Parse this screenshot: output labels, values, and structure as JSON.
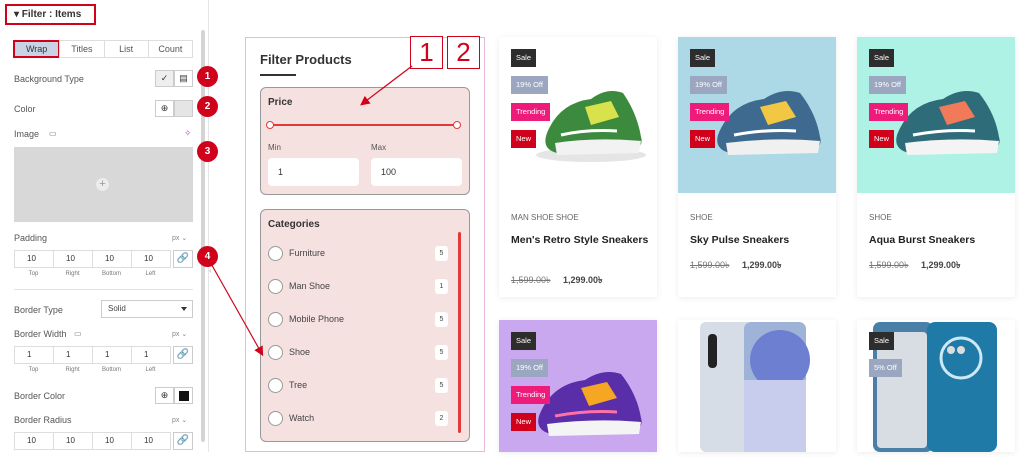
{
  "panel": {
    "section_title": "▾ Filter : Items",
    "tabs": [
      "Wrap",
      "Titles",
      "List",
      "Count"
    ],
    "background_type_label": "Background Type",
    "bg_icon_1": "✓",
    "bg_icon_2": "▤",
    "color_label": "Color",
    "color_icon": "⊕",
    "image_label": "Image",
    "image_icon": "▭",
    "ai_icon": "✧",
    "plus_icon": "+",
    "padding_label": "Padding",
    "padding_unit": "px ⌄",
    "padding_values": [
      "10",
      "10",
      "10",
      "10"
    ],
    "side_labels": [
      "Top",
      "Right",
      "Bottom",
      "Left"
    ],
    "link_icon": "🔗",
    "border_type_label": "Border Type",
    "border_type_value": "Solid",
    "border_width_label": "Border Width",
    "border_width_unit": "px ⌄",
    "border_width_values": [
      "1",
      "1",
      "1",
      "1"
    ],
    "border_color_label": "Border Color",
    "border_radius_label": "Border Radius",
    "border_radius_unit": "px ⌄",
    "border_radius_values": [
      "10",
      "10",
      "10",
      "10"
    ],
    "markers": [
      "1",
      "2",
      "3",
      "4"
    ],
    "collapse_icon": "‹"
  },
  "filter": {
    "title": "Filter Products",
    "callouts": [
      "1",
      "2"
    ],
    "price_label": "Price",
    "min_label": "Min",
    "max_label": "Max",
    "min_value": "1",
    "max_value": "100",
    "categories_label": "Categories",
    "categories": [
      {
        "name": "Furniture",
        "count": "5"
      },
      {
        "name": "Man Shoe",
        "count": "1"
      },
      {
        "name": "Mobile Phone",
        "count": "5"
      },
      {
        "name": "Shoe",
        "count": "5"
      },
      {
        "name": "Tree",
        "count": "5"
      },
      {
        "name": "Watch",
        "count": "2"
      }
    ]
  },
  "products": [
    {
      "category": "MAN SHOE   SHOE",
      "name": "Men's Retro Style Sneakers",
      "old_price": "1,599.00৳",
      "new_price": "1,299.00৳",
      "badges": [
        "Sale",
        "19% Off",
        "Trending",
        "New"
      ]
    },
    {
      "category": "SHOE",
      "name": "Sky Pulse Sneakers",
      "old_price": "1,599.00৳",
      "new_price": "1,299.00৳",
      "badges": [
        "Sale",
        "19% Off",
        "Trending",
        "New"
      ]
    },
    {
      "category": "SHOE",
      "name": "Aqua Burst Sneakers",
      "old_price": "1,599.00৳",
      "new_price": "1,299.00৳",
      "badges": [
        "Sale",
        "19% Off",
        "Trending",
        "New"
      ]
    },
    {
      "badges": [
        "Sale",
        "19% Off",
        "Trending",
        "New"
      ]
    },
    {},
    {
      "badges": [
        "Sale",
        "5% Off"
      ]
    }
  ],
  "colors": {
    "accent_red": "#d0021b",
    "slider_red": "#e23a3a",
    "trending_pink": "#ef1b7b",
    "filter_bg": "#f6e1e1",
    "card2_bg": "#add8e6",
    "card3_bg": "#aef2e6",
    "card4_bg": "#c9a8f0"
  }
}
